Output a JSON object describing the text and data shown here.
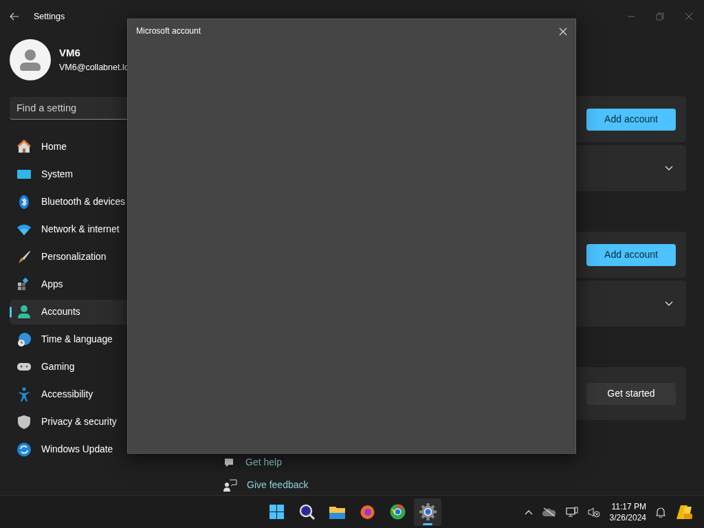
{
  "window": {
    "title": "Settings"
  },
  "user": {
    "name": "VM6",
    "email": "VM6@collabnet.lo"
  },
  "search": {
    "placeholder": "Find a setting"
  },
  "nav": [
    {
      "label": "Home",
      "selected": false
    },
    {
      "label": "System",
      "selected": false
    },
    {
      "label": "Bluetooth & devices",
      "selected": false
    },
    {
      "label": "Network & internet",
      "selected": false
    },
    {
      "label": "Personalization",
      "selected": false
    },
    {
      "label": "Apps",
      "selected": false
    },
    {
      "label": "Accounts",
      "selected": true
    },
    {
      "label": "Time & language",
      "selected": false
    },
    {
      "label": "Gaming",
      "selected": false
    },
    {
      "label": "Accessibility",
      "selected": false
    },
    {
      "label": "Privacy & security",
      "selected": false
    },
    {
      "label": "Windows Update",
      "selected": false
    }
  ],
  "sections": [
    {
      "cards": [
        {
          "kind": "button",
          "button": "Add account",
          "primary": true
        },
        {
          "kind": "expander"
        }
      ]
    },
    {
      "cards": [
        {
          "kind": "button",
          "button": "Add account",
          "primary": true
        },
        {
          "kind": "expander"
        }
      ]
    },
    {
      "cards": [
        {
          "kind": "button",
          "button": "Get started",
          "primary": false
        }
      ]
    }
  ],
  "links": [
    "Get help",
    "Give feedback"
  ],
  "dialog": {
    "title": "Microsoft account"
  },
  "taskbar": {
    "apps": [
      {
        "selected": false
      },
      {
        "selected": false
      },
      {
        "selected": false
      },
      {
        "selected": false
      },
      {
        "selected": false
      },
      {
        "selected": true
      }
    ],
    "time": "11:17 PM",
    "date": "3/26/2024"
  }
}
